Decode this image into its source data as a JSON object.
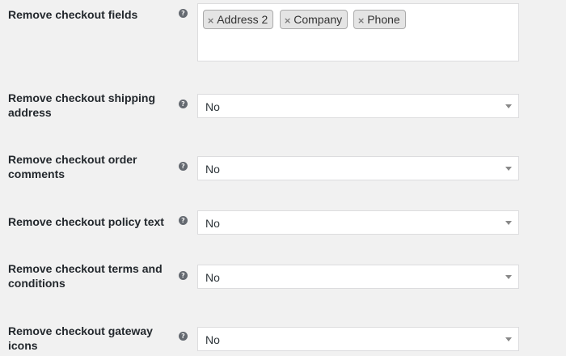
{
  "settings": {
    "checkout_fields": {
      "label": "Remove checkout fields",
      "tags": [
        {
          "label": "Address 2",
          "remove_glyph": "×"
        },
        {
          "label": "Company",
          "remove_glyph": "×"
        },
        {
          "label": "Phone",
          "remove_glyph": "×"
        }
      ]
    },
    "shipping_address": {
      "label_line1": "Remove checkout shipping",
      "label_line2": "address",
      "value": "No"
    },
    "order_comments": {
      "label_line1": "Remove checkout order",
      "label_line2": "comments",
      "value": "No"
    },
    "policy_text": {
      "label_line1": "Remove checkout policy text",
      "value": "No"
    },
    "terms_conditions": {
      "label_line1": "Remove checkout terms and",
      "label_line2": "conditions",
      "value": "No"
    },
    "gateway_icons": {
      "label_line1": "Remove checkout gateway",
      "label_line2": "icons",
      "value": "No"
    }
  },
  "help_icon_glyph": "?",
  "icons": {
    "help": "help-icon",
    "tag_remove": "close-icon",
    "dropdown": "chevron-down-icon"
  },
  "colors": {
    "background": "#f1f1f1",
    "field_border": "#dcdcde",
    "tag_background": "#e4e4e4",
    "help_icon": "#646970"
  }
}
